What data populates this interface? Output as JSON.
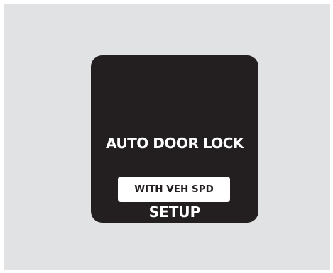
{
  "display": {
    "title": "AUTO DOOR LOCK",
    "selected_option": "WITH VEH SPD",
    "mode_label": "SETUP"
  },
  "colors": {
    "background_panel": "#e1e2e4",
    "screen": "#231f20",
    "text_on_screen": "#ffffff",
    "option_box": "#ffffff"
  }
}
